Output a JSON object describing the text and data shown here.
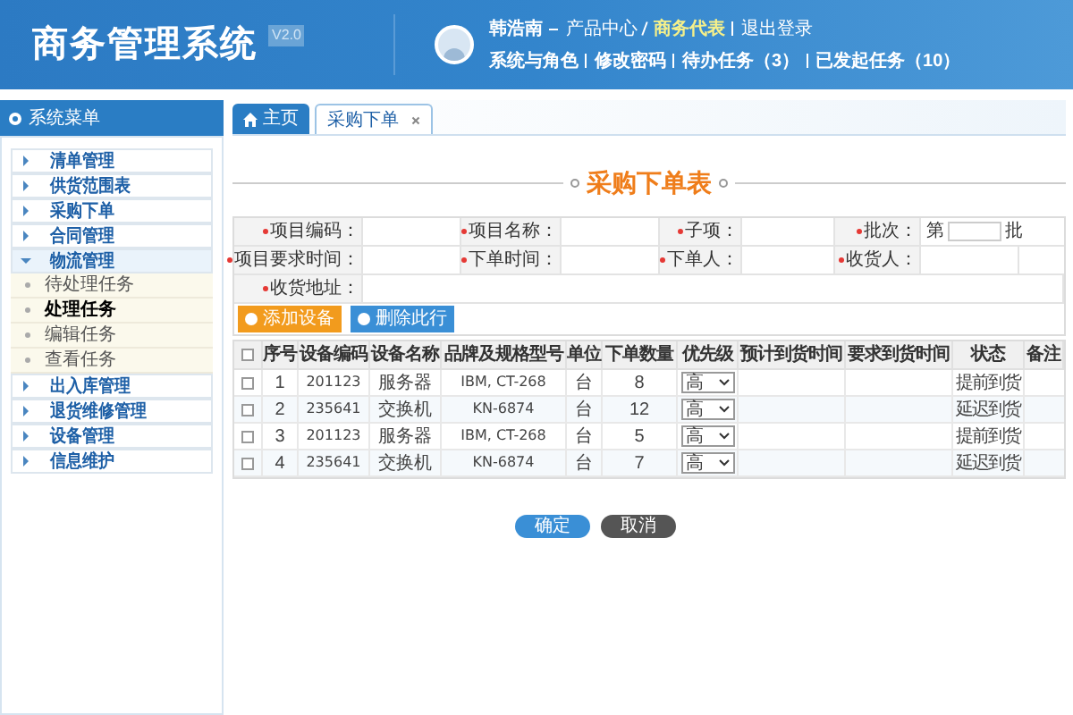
{
  "header": {
    "title": "商务管理系统",
    "version": "V2.0",
    "user": "韩浩南",
    "breadcrumb": [
      {
        "label": "产品中心",
        "selected": false
      },
      {
        "label": "商务代表",
        "selected": true
      }
    ],
    "logout": "退出登录",
    "links": [
      "系统与角色",
      "修改密码",
      "待办任务（3）",
      "已发起任务（10）"
    ]
  },
  "sidebar": {
    "title": "系统菜单",
    "items": [
      {
        "label": "清单管理",
        "expanded": false
      },
      {
        "label": "供货范围表",
        "expanded": false
      },
      {
        "label": "采购下单",
        "expanded": false
      },
      {
        "label": "合同管理",
        "expanded": false
      },
      {
        "label": "物流管理",
        "expanded": true,
        "children": [
          {
            "label": "待处理任务",
            "selected": false
          },
          {
            "label": "处理任务",
            "selected": true
          },
          {
            "label": "编辑任务",
            "selected": false
          },
          {
            "label": "查看任务",
            "selected": false
          }
        ]
      },
      {
        "label": "出入库管理",
        "expanded": false
      },
      {
        "label": "退货维修管理",
        "expanded": false
      },
      {
        "label": "设备管理",
        "expanded": false
      },
      {
        "label": "信息维护",
        "expanded": false
      }
    ]
  },
  "tabs": [
    {
      "label": "主页",
      "kind": "home",
      "selected": false
    },
    {
      "label": "采购下单",
      "kind": "closable",
      "selected": true
    }
  ],
  "form": {
    "title": "采购下单表",
    "rows": [
      [
        {
          "label": "项目编码：",
          "required": true
        },
        {
          "label": "项目名称：",
          "required": true
        },
        {
          "label": "子项：",
          "required": true
        },
        {
          "label": "批次：",
          "required": true,
          "kind": "batch",
          "prefix": "第",
          "suffix": "批"
        }
      ],
      [
        {
          "label": "项目要求时间：",
          "required": true
        },
        {
          "label": "下单时间：",
          "required": true
        },
        {
          "label": "下单人：",
          "required": true
        },
        {
          "label": "收货人：",
          "required": true
        }
      ],
      [
        {
          "label": "收货地址：",
          "required": true,
          "kind": "wide"
        }
      ]
    ],
    "actions": [
      {
        "label": "添加设备",
        "kind": "add"
      },
      {
        "label": "删除此行",
        "kind": "delete"
      }
    ]
  },
  "table": {
    "all_checked": false,
    "columns": [
      "序号",
      "设备编码",
      "设备名称",
      "品牌及规格型号",
      "单位",
      "下单数量",
      "优先级",
      "预计到货时间",
      "要求到货时间",
      "状态",
      "备注"
    ],
    "rows": [
      {
        "checked": false,
        "cells": [
          "1",
          "201123",
          "服务器",
          "IBM, CT-268",
          "台",
          "8"
        ],
        "priority": "高",
        "status": "提前到货"
      },
      {
        "checked": false,
        "cells": [
          "2",
          "235641",
          "交换机",
          "KN-6874",
          "台",
          "12"
        ],
        "priority": "高",
        "status": "延迟到货"
      },
      {
        "checked": false,
        "cells": [
          "3",
          "201123",
          "服务器",
          "IBM, CT-268",
          "台",
          "5"
        ],
        "priority": "高",
        "status": "提前到货"
      },
      {
        "checked": false,
        "cells": [
          "4",
          "235641",
          "交换机",
          "KN-6874",
          "台",
          "7"
        ],
        "priority": "高",
        "status": "延迟到货"
      }
    ]
  },
  "buttons": [
    {
      "label": "确定",
      "kind": "primary"
    },
    {
      "label": "取消",
      "kind": "secondary"
    }
  ]
}
